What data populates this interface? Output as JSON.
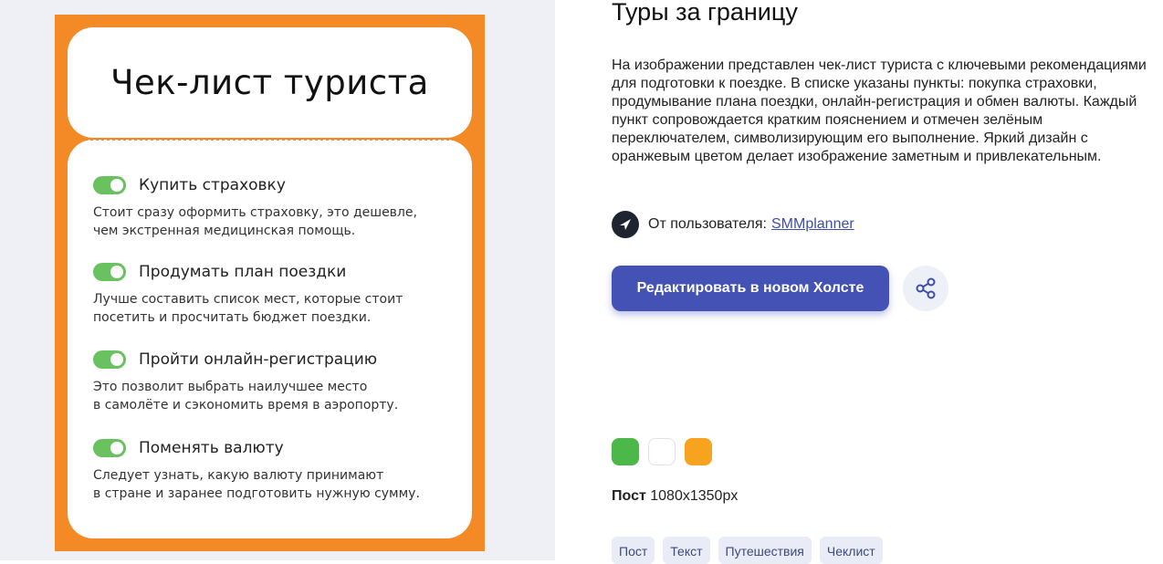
{
  "preview": {
    "heading": "Чек-лист туриста",
    "items": [
      {
        "title": "Купить страховку",
        "desc1": "Стоит сразу оформить страховку, это дешевле,",
        "desc2": "чем экстренная медицинская помощь."
      },
      {
        "title": "Продумать план поездки",
        "desc1": "Лучше составить список мест, которые стоит",
        "desc2": "посетить и просчитать бюджет поездки."
      },
      {
        "title": "Пройти онлайн-регистрацию",
        "desc1": "Это позволит выбрать наилучшее место",
        "desc2": "в самолёте и сэкономить время в аэропорту."
      },
      {
        "title": "Поменять валюту",
        "desc1": "Следует узнать, какую валюту принимают",
        "desc2": "в стране и заранее подготовить нужную сумму."
      }
    ]
  },
  "info": {
    "title": "Туры за границу",
    "description": "На изображении представлен чек-лист туриста с ключевыми рекомендациями для подготовки к поездке. В списке указаны пункты: покупка страховки, продумывание плана поездки, онлайн-регистрация и обмен валюты. Каждый пункт сопровождается кратким пояснением и отмечен зелёным переключателем, символизирующим его выполнение. Яркий дизайн с оранжевым цветом делает изображение заметным и привлекательным.",
    "author_label": "От пользователя:",
    "author_name": "SMMplanner",
    "edit_button": "Редактировать в новом Холсте",
    "swatches": [
      "#4cb84a",
      "#ffffff",
      "#f7a320"
    ],
    "format_label": "Пост",
    "format_size": "1080x1350px",
    "tags": [
      "Пост",
      "Текст",
      "Путешествия",
      "Чеклист"
    ]
  }
}
